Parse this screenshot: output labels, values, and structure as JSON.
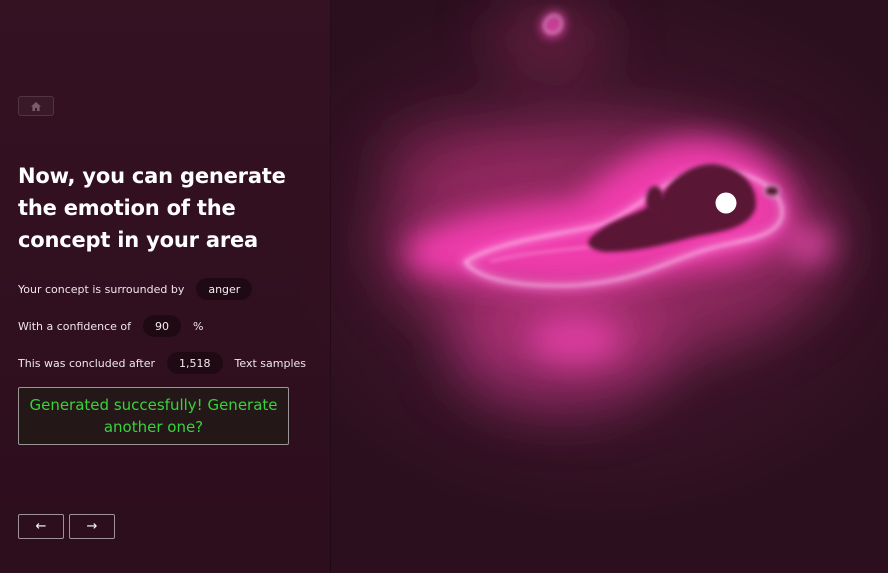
{
  "nav": {
    "home_icon": "home-icon",
    "prev_label": "←",
    "next_label": "→"
  },
  "main": {
    "title": "Now, you can generate the emotion of the concept in your area",
    "emotion_prefix": "Your concept is surrounded by",
    "emotion_value": "anger",
    "confidence_prefix": "With a confidence of",
    "confidence_value": "90",
    "confidence_unit": "%",
    "samples_prefix": "This was concluded after",
    "samples_value": "1,518",
    "samples_suffix": "Text samples",
    "success_message": "Generated succesfully! Generate another one?"
  },
  "colors": {
    "background": "#2b0f1e",
    "glow": "#ff4fd0",
    "success_text": "#39d23b"
  }
}
